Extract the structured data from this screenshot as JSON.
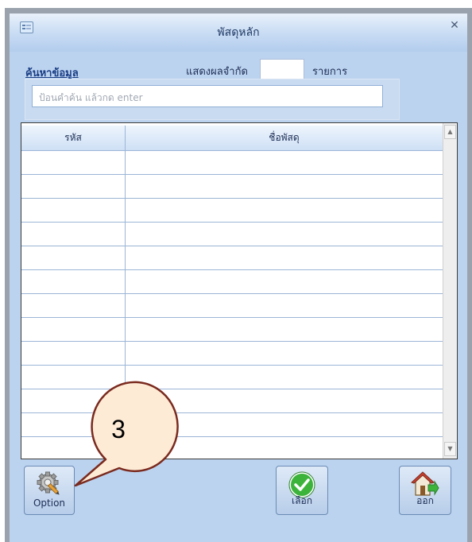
{
  "window": {
    "title": "พัสดุหลัก",
    "close_glyph": "✕"
  },
  "search": {
    "label": "ค้นหาข้อมูล",
    "limit_label": "แสดงผลจำกัด",
    "limit_value": "",
    "unit_label": "รายการ",
    "placeholder": "ป้อนคำค้น แล้วกด enter"
  },
  "grid": {
    "headers": {
      "code": "รหัส",
      "name": "ชื่อพัสดุ"
    },
    "rows": 13
  },
  "buttons": {
    "option": "Option",
    "select": "เลือก",
    "exit": "ออก"
  },
  "icons": {
    "option": "gear-pencil-icon",
    "select": "check-circle-icon",
    "exit": "house-exit-icon"
  },
  "annotation": {
    "number": "3"
  },
  "colors": {
    "window_bg": "#bcd3ef",
    "title_text": "#203a66",
    "select_green": "#3cb43c",
    "callout_fill": "#fdebd6",
    "callout_stroke": "#7a2a1e"
  }
}
